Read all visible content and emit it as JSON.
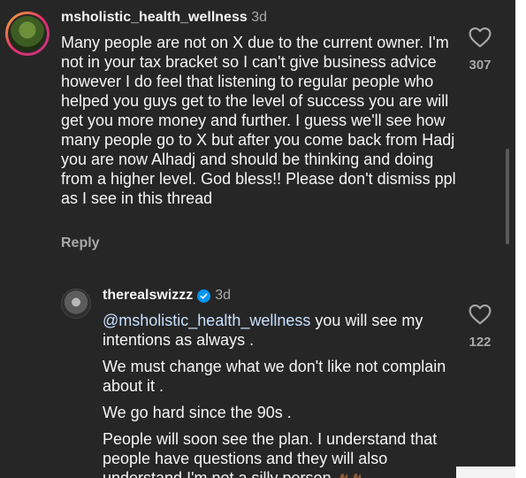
{
  "comment1": {
    "username": "msholistic_health_wellness",
    "time": "3d",
    "text": "Many people are not on X due to the current owner. I'm not in your tax bracket so I can't give business advice however I do feel that listening to regular people who helped you guys get to the level of success you are will get you more money and further. I guess we'll see how many people go to X but after you come back from Hadj you are now Alhadj and should be thinking and doing from a higher level. God bless!! Please don't dismiss ppl as I see in this thread",
    "likes": "307",
    "reply_label": "Reply",
    "avatar_icon": "profile-avatar"
  },
  "comment2": {
    "username": "therealswizzz",
    "time": "3d",
    "verified_icon": "verified-badge-icon",
    "mention": "@msholistic_health_wellness",
    "line1_rest": " you will see my intentions as always .",
    "line2": "We must change what we don't like not complain about it .",
    "line3": "We go hard since the 90s .",
    "line4": "People will soon see the plan. I understand that people have questions and they will also understand I'm not a silly person",
    "likes": "122",
    "emoji": "folded-hands-emoji"
  },
  "colors": {
    "background": "#262626",
    "text": "#f5f5f5",
    "secondary": "#a8a8a8",
    "verified": "#0095f6"
  }
}
